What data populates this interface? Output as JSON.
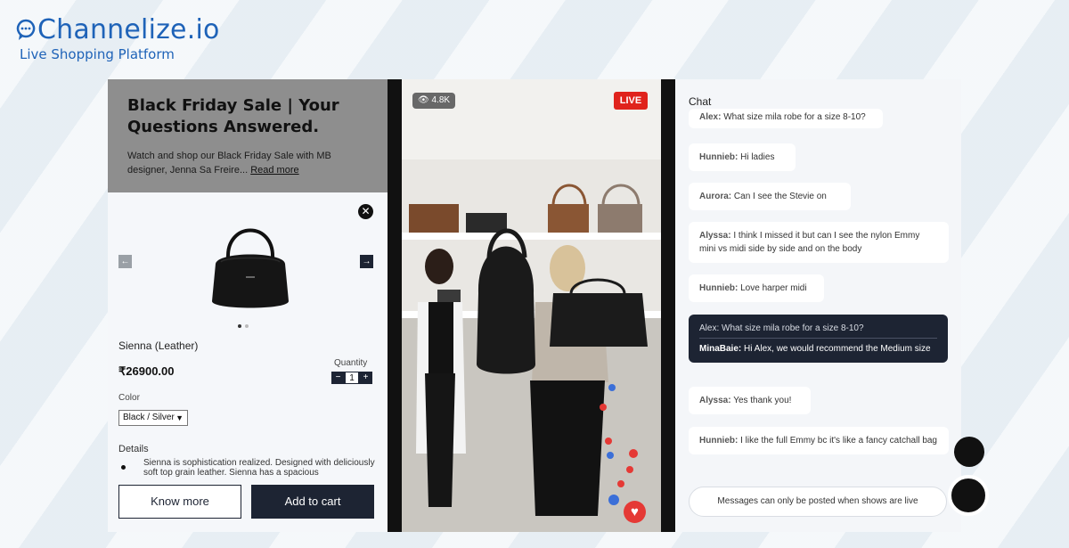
{
  "brand": {
    "name": "Channelize.io",
    "tagline": "Live Shopping Platform"
  },
  "show": {
    "title": "Black Friday Sale | Your Questions Answered.",
    "description": "Watch and shop our Black Friday Sale with MB designer, Jenna Sa Freire...",
    "read_more": "Read more"
  },
  "product": {
    "close_icon": "close-icon",
    "name": "Sienna (Leather)",
    "price": "₹26900.00",
    "quantity_label": "Quantity",
    "quantity": "1",
    "qty_minus": "−",
    "qty_plus": "+",
    "color_label": "Color",
    "color_value": "Black / Silver",
    "details_label": "Details",
    "details_text": "Sienna is sophistication realized. Designed with deliciously soft top grain leather. Sienna has a spacious",
    "know_more": "Know more",
    "add_to_cart": "Add to cart"
  },
  "video": {
    "viewers": "4.8K",
    "live": "LIVE"
  },
  "chat": {
    "title": "Chat",
    "messages": [
      {
        "user": "Alex:",
        "text": "What size mila robe for a size 8-10?"
      },
      {
        "user": "Hunnieb:",
        "text": "Hi ladies"
      },
      {
        "user": "Aurora:",
        "text": "Can I see the Stevie on"
      },
      {
        "user": "Alyssa:",
        "text": "I think I missed it but can I see the nylon Emmy mini vs midi side by side and on the body"
      },
      {
        "user": "Hunnieb:",
        "text": "Love harper midi"
      },
      {
        "quote": "Alex: What size mila robe for a size 8-10?",
        "user": "MinaBaie:",
        "text": "Hi Alex, we would recommend the Medium size"
      },
      {
        "user": "Alyssa:",
        "text": "Yes thank you!"
      },
      {
        "user": "Hunnieb:",
        "text": "I like the full Emmy bc it's like a fancy catchall bag"
      }
    ],
    "input_placeholder": "Messages can only be posted when shows are live"
  },
  "colors": {
    "brand": "#1f63b8",
    "live": "#e0231c",
    "dark": "#1d2433"
  }
}
